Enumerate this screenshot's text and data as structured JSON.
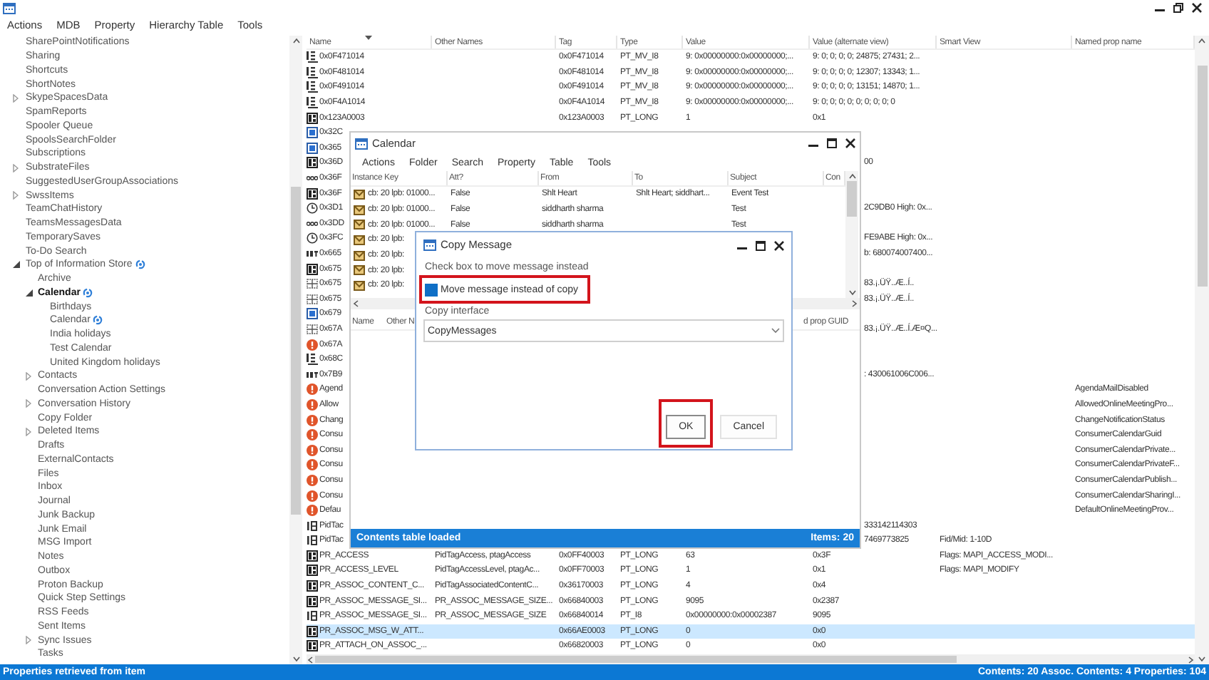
{
  "menu": [
    "Actions",
    "MDB",
    "Property",
    "Hierarchy Table",
    "Tools"
  ],
  "tree": [
    {
      "label": "SharePointNotifications",
      "selected": false
    },
    {
      "label": "Sharing",
      "selected": false
    },
    {
      "label": "Shortcuts",
      "selected": false
    },
    {
      "label": "ShortNotes",
      "selected": false
    },
    {
      "label": "SkypeSpacesData",
      "selected": false,
      "expanded": false
    },
    {
      "label": "SpamReports",
      "selected": false
    },
    {
      "label": "Spooler Queue",
      "selected": false
    },
    {
      "label": "SpoolsSearchFolder",
      "selected": false
    },
    {
      "label": "Subscriptions",
      "selected": false
    },
    {
      "label": "SubstrateFiles",
      "selected": false,
      "expanded": false
    },
    {
      "label": "SuggestedUserGroupAssociations",
      "selected": false
    },
    {
      "label": "SwssItems",
      "selected": false,
      "expanded": false
    },
    {
      "label": "TeamChatHistory",
      "selected": false
    },
    {
      "label": "TeamsMessagesData",
      "selected": false
    },
    {
      "label": "TemporarySaves",
      "selected": false
    },
    {
      "label": "To-Do Search",
      "selected": false
    },
    {
      "label": "Top of Information Store",
      "selected": false,
      "expanded": true,
      "synced": true,
      "children": [
        {
          "label": "Archive",
          "selected": false
        },
        {
          "label": "Calendar",
          "selected": true,
          "expanded": true,
          "synced": true,
          "children": [
            {
              "label": "Birthdays",
              "selected": false
            },
            {
              "label": "Calendar",
              "selected": false,
              "synced": true
            },
            {
              "label": "India holidays",
              "selected": false
            },
            {
              "label": "Test Calendar",
              "selected": false
            },
            {
              "label": "United Kingdom holidays",
              "selected": false
            }
          ]
        },
        {
          "label": "Contacts",
          "selected": false,
          "expanded": false
        },
        {
          "label": "Conversation Action Settings",
          "selected": false
        },
        {
          "label": "Conversation History",
          "selected": false,
          "expanded": false
        },
        {
          "label": "Copy Folder",
          "selected": false
        },
        {
          "label": "Deleted Items",
          "selected": false,
          "expanded": false
        },
        {
          "label": "Drafts",
          "selected": false
        },
        {
          "label": "ExternalContacts",
          "selected": false
        },
        {
          "label": "Files",
          "selected": false
        },
        {
          "label": "Inbox",
          "selected": false
        },
        {
          "label": "Journal",
          "selected": false
        },
        {
          "label": "Junk Backup",
          "selected": false
        },
        {
          "label": "Junk Email",
          "selected": false
        },
        {
          "label": "MSG Import",
          "selected": false
        },
        {
          "label": "Notes",
          "selected": false
        },
        {
          "label": "Outbox",
          "selected": false
        },
        {
          "label": "Proton Backup",
          "selected": false
        },
        {
          "label": "Quick Step Settings",
          "selected": false
        },
        {
          "label": "RSS Feeds",
          "selected": false
        },
        {
          "label": "Sent Items",
          "selected": false
        },
        {
          "label": "Sync Issues",
          "selected": false,
          "expanded": false
        },
        {
          "label": "Tasks",
          "selected": false
        }
      ]
    }
  ],
  "properties": {
    "columns": [
      {
        "label": "Name",
        "sorted": true
      },
      {
        "label": "Other Names",
        "sorted": false
      },
      {
        "label": "Tag",
        "sorted": false
      },
      {
        "label": "Type",
        "sorted": false
      },
      {
        "label": "Value",
        "sorted": false
      },
      {
        "label": "Value (alternate view)",
        "sorted": false
      },
      {
        "label": "Smart View",
        "sorted": false
      },
      {
        "label": "Named prop name",
        "sorted": false
      }
    ],
    "rows": [
      {
        "kind": "multi",
        "name": "0x0F471014",
        "tag": "0x0F471014",
        "type": "PT_MV_I8",
        "value": "9: 0x00000000:0x00000000;...",
        "alt": "9: 0; 0; 0; 0; 24875; 27431; 2...",
        "selected": false
      },
      {
        "kind": "multi",
        "name": "0x0F481014",
        "tag": "0x0F481014",
        "type": "PT_MV_I8",
        "value": "9: 0x00000000:0x00000000;...",
        "alt": "9: 0; 0; 0; 0; 12307; 13343; 1...",
        "selected": false
      },
      {
        "kind": "multi",
        "name": "0x0F491014",
        "tag": "0x0F491014",
        "type": "PT_MV_I8",
        "value": "9: 0x00000000:0x00000000;...",
        "alt": "9: 0; 0; 0; 0; 13151; 14870; 1...",
        "selected": false
      },
      {
        "kind": "multi",
        "name": "0x0F4A1014",
        "tag": "0x0F4A1014",
        "type": "PT_MV_I8",
        "value": "9: 0x00000000:0x00000000;...",
        "alt": "9: 0; 0; 0; 0; 0; 0; 0; 0; 0",
        "selected": false
      },
      {
        "kind": "long",
        "name": "0x123A0003",
        "tag": "0x123A0003",
        "type": "PT_LONG",
        "value": "1",
        "alt": "0x1",
        "selected": false
      },
      {
        "kind": "binary",
        "name": "0x32C",
        "selected": false
      },
      {
        "kind": "binary",
        "name": "0x365",
        "selected": false
      },
      {
        "kind": "long",
        "name": "0x36D",
        "tail": "00",
        "selected": false
      },
      {
        "kind": "string",
        "name": "0x36F",
        "selected": false
      },
      {
        "kind": "long",
        "name": "0x36F",
        "selected": false
      },
      {
        "kind": "time",
        "name": "0x3D1",
        "tail": "2C9DB0 High: 0x...",
        "selected": false
      },
      {
        "kind": "string",
        "name": "0x3DD",
        "selected": false
      },
      {
        "kind": "time",
        "name": "0x3FC",
        "tail": "FE9ABE High: 0x...",
        "selected": false
      },
      {
        "kind": "int",
        "name": "0x665",
        "tail": "b: 680074007400...",
        "selected": false
      },
      {
        "kind": "long",
        "name": "0x675",
        "selected": false
      },
      {
        "kind": "grid",
        "name": "0x675",
        "tail": "83.¡.ÜŸ..Æ..Í..",
        "selected": false
      },
      {
        "kind": "grid",
        "name": "0x675",
        "tail": "83.¡.ÜŸ..Æ..Í..",
        "selected": false
      },
      {
        "kind": "binary",
        "name": "0x679",
        "selected": false
      },
      {
        "kind": "grid",
        "name": "0x67A",
        "tail": "83.¡.ÜŸ..Æ..Í.Æ¤Q...",
        "selected": false
      },
      {
        "kind": "error",
        "name": "0x67A",
        "selected": false
      },
      {
        "kind": "multi",
        "name": "0x68C",
        "selected": false
      },
      {
        "kind": "int",
        "name": "0x7B9",
        "tail": ": 430061006C006...",
        "selected": false
      },
      {
        "kind": "error",
        "name": "Agend",
        "named": "AgendaMailDisabled",
        "selected": false
      },
      {
        "kind": "error",
        "name": "Allow",
        "named": "AllowedOnlineMeetingPro...",
        "selected": false
      },
      {
        "kind": "error",
        "name": "Chang",
        "named": "ChangeNotificationStatus",
        "selected": false
      },
      {
        "kind": "error",
        "name": "Consu",
        "named": "ConsumerCalendarGuid",
        "selected": false
      },
      {
        "kind": "error",
        "name": "Consu",
        "named": "ConsumerCalendarPrivate...",
        "selected": false
      },
      {
        "kind": "error",
        "name": "Consu",
        "named": "ConsumerCalendarPrivateF...",
        "selected": false
      },
      {
        "kind": "error",
        "name": "Consu",
        "named": "ConsumerCalendarPublish...",
        "selected": false
      },
      {
        "kind": "error",
        "name": "Consu",
        "named": "ConsumerCalendarSharingI...",
        "selected": false
      },
      {
        "kind": "error",
        "name": "Defau",
        "named": "DefaultOnlineMeetingProv...",
        "selected": false
      },
      {
        "kind": "i8",
        "name": "PidTac",
        "tail": "333142114303",
        "selected": false
      },
      {
        "kind": "i8",
        "name": "PidTac",
        "tail": "7469773825",
        "smart": "Fid/Mid: 1-10D",
        "selected": false
      },
      {
        "kind": "long",
        "name": "PR_ACCESS",
        "other": "PidTagAccess, ptagAccess",
        "tag": "0x0FF40003",
        "type": "PT_LONG",
        "value": "63",
        "alt": "0x3F",
        "smart": "Flags: MAPI_ACCESS_MODI...",
        "selected": false
      },
      {
        "kind": "long",
        "name": "PR_ACCESS_LEVEL",
        "other": "PidTagAccessLevel, ptagAc...",
        "tag": "0x0FF70003",
        "type": "PT_LONG",
        "value": "1",
        "alt": "0x1",
        "smart": "Flags: MAPI_MODIFY",
        "selected": false
      },
      {
        "kind": "long",
        "name": "PR_ASSOC_CONTENT_C...",
        "other": "PidTagAssociatedContentC...",
        "tag": "0x36170003",
        "type": "PT_LONG",
        "value": "4",
        "alt": "0x4",
        "selected": false
      },
      {
        "kind": "long",
        "name": "PR_ASSOC_MESSAGE_SI...",
        "other": "PR_ASSOC_MESSAGE_SIZE...",
        "tag": "0x66840003",
        "type": "PT_LONG",
        "value": "9095",
        "alt": "0x2387",
        "selected": false
      },
      {
        "kind": "i8",
        "name": "PR_ASSOC_MESSAGE_SI...",
        "other": "PR_ASSOC_MESSAGE_SIZE",
        "tag": "0x66840014",
        "type": "PT_I8",
        "value": "0x00000000:0x00002387",
        "alt": "9095",
        "selected": false
      },
      {
        "kind": "long",
        "name": "PR_ASSOC_MSG_W_ATT...",
        "tag": "0x66AE0003",
        "type": "PT_LONG",
        "value": "0",
        "alt": "0x0",
        "selected": true
      },
      {
        "kind": "long",
        "name": "PR_ATTACH_ON_ASSOC_...",
        "tag": "0x66820003",
        "type": "PT_LONG",
        "value": "0",
        "alt": "0x0",
        "selected": false
      }
    ]
  },
  "calendar_window": {
    "title": "Calendar",
    "menu": [
      "Actions",
      "Folder",
      "Search",
      "Property",
      "Table",
      "Tools"
    ],
    "columns": [
      "Instance Key",
      "Att?",
      "From",
      "To",
      "Subject",
      "Con"
    ],
    "rows": [
      {
        "key": "cb: 20 lpb: 01000...",
        "att": "False",
        "from": "Shlt Heart",
        "to": "Shlt Heart; siddhart...",
        "subject": "Event Test"
      },
      {
        "key": "cb: 20 lpb: 01000...",
        "att": "False",
        "from": "siddharth sharma",
        "subject": "Test"
      },
      {
        "key": "cb: 20 lpb: 01000...",
        "att": "False",
        "from": "siddharth sharma",
        "subject": "Test"
      },
      {
        "key": "cb: 20 lpb:"
      },
      {
        "key": "cb: 20 lpb:"
      },
      {
        "key": "cb: 20 lpb:"
      },
      {
        "key": "cb: 20 lpb:"
      }
    ],
    "lower_columns": [
      "Name",
      "Other N"
    ],
    "lower_right_column": "d prop GUID",
    "status": "Contents table loaded",
    "items": "Items: 20"
  },
  "copy_dialog": {
    "title": "Copy Message",
    "instruction": "Check box to move message instead",
    "checkbox": {
      "label": "Move message instead of copy",
      "checked": true,
      "highlighted": true
    },
    "interface_label": "Copy interface",
    "interface_value": "CopyMessages",
    "buttons": [
      {
        "label": "OK",
        "focused": true,
        "highlighted": true
      },
      {
        "label": "Cancel",
        "focused": false,
        "highlighted": false
      }
    ]
  },
  "status_bar": {
    "left": "Properties retrieved from item",
    "right": "Contents: 20 Assoc. Contents: 4 Properties: 104"
  }
}
